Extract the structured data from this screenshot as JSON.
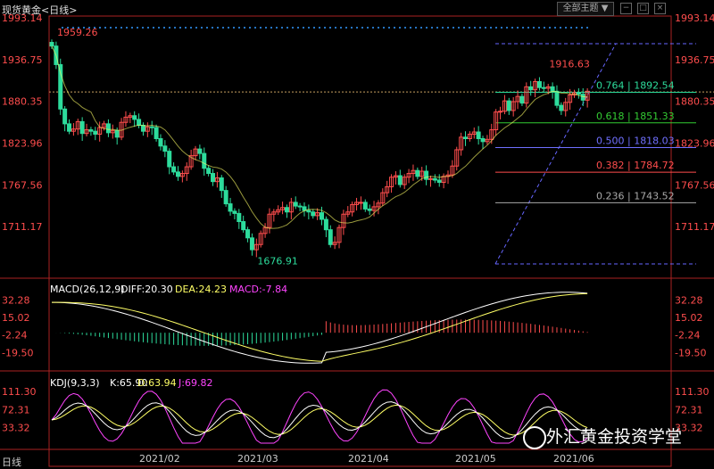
{
  "window": {
    "title": "现货黄金<日线>",
    "theme_button": "全部主题",
    "period_label": "日线",
    "watermark": "外汇黄金投资学堂"
  },
  "colors": {
    "up": "#ff4d4d",
    "down": "#2ddc9c",
    "ma_line": "#ffff66",
    "diff_line": "#ffffff",
    "k_line": "#ffffff",
    "d_line": "#ffff66",
    "j_line": "#ff44ff",
    "dotted_ref": "#c8a060",
    "fib_0764": "#2ddc9c",
    "fib_0618": "#33cc33",
    "fib_0500": "#7070ff",
    "fib_0382": "#ff4d4d",
    "fib_0236": "#aaaaaa",
    "channel": "#6666ff"
  },
  "chart_data": [
    {
      "type": "candlestick",
      "panel": "price",
      "y_ticks": [
        1993.14,
        1936.75,
        1880.35,
        1823.96,
        1767.56,
        1711.17
      ],
      "ylim": [
        1650,
        1993.14
      ],
      "x_ticks": [
        "2021/02",
        "2021/03",
        "2021/04",
        "2021/05",
        "2021/06"
      ],
      "annotations": [
        {
          "label": "1959.26",
          "value": 1959.26
        },
        {
          "label": "1676.91",
          "value": 1676.91
        },
        {
          "label": "1916.63",
          "value": 1916.63
        }
      ],
      "fibonacci": [
        {
          "label": "0.764 | 1892.54",
          "ratio": 0.764,
          "value": 1892.54
        },
        {
          "label": "0.618 | 1851.33",
          "ratio": 0.618,
          "value": 1851.33
        },
        {
          "label": "0.500 | 1818.03",
          "ratio": 0.5,
          "value": 1818.03
        },
        {
          "label": "0.382 | 1784.72",
          "ratio": 0.382,
          "value": 1784.72
        },
        {
          "label": "0.236 | 1743.52",
          "ratio": 0.236,
          "value": 1743.52
        }
      ],
      "reference_level": 1893,
      "close": [
        1955,
        1930,
        1870,
        1850,
        1840,
        1843,
        1853,
        1837,
        1842,
        1840,
        1836,
        1845,
        1850,
        1838,
        1841,
        1832,
        1852,
        1859,
        1861,
        1856,
        1848,
        1840,
        1846,
        1845,
        1830,
        1820,
        1813,
        1792,
        1785,
        1779,
        1783,
        1792,
        1807,
        1816,
        1810,
        1790,
        1783,
        1772,
        1777,
        1760,
        1742,
        1732,
        1729,
        1718,
        1707,
        1696,
        1680,
        1687,
        1702,
        1710,
        1728,
        1731,
        1734,
        1737,
        1731,
        1744,
        1739,
        1738,
        1733,
        1731,
        1726,
        1730,
        1721,
        1707,
        1687,
        1690,
        1710,
        1728,
        1731,
        1741,
        1744,
        1744,
        1735,
        1733,
        1738,
        1743,
        1757,
        1765,
        1778,
        1780,
        1768,
        1778,
        1783,
        1787,
        1779,
        1786,
        1775,
        1776,
        1774,
        1771,
        1779,
        1781,
        1793,
        1815,
        1832,
        1830,
        1836,
        1839,
        1830,
        1826,
        1829,
        1842,
        1866,
        1867,
        1881,
        1868,
        1880,
        1887,
        1878,
        1900,
        1896,
        1907,
        1899,
        1898,
        1900,
        1894,
        1875,
        1868,
        1879,
        1889,
        1892,
        1890,
        1882,
        1894
      ]
    },
    {
      "type": "macd",
      "panel": "macd",
      "params": "MACD(26,12,9)",
      "diff_label": "DIFF:20.30",
      "dea_label": "DEA:24.23",
      "macd_label": "MACD:-7.84",
      "y_ticks": [
        32.28,
        15.02,
        -2.24,
        -19.5
      ],
      "ylim": [
        -28,
        38
      ]
    },
    {
      "type": "kdj",
      "panel": "kdj",
      "params": "KDJ(9,3,3)",
      "k_label": "K:65.90",
      "d_label": "D:63.94",
      "j_label": "J:69.82",
      "y_ticks": [
        111.3,
        72.31,
        33.32
      ],
      "ylim": [
        0,
        125
      ]
    }
  ]
}
